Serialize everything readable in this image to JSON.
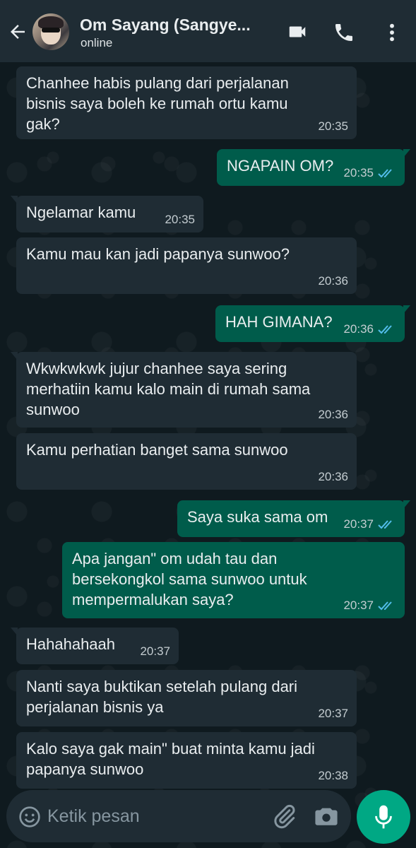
{
  "header": {
    "title": "Om Sayang (Sangye...",
    "status": "online"
  },
  "messages": [
    {
      "dir": "in",
      "text": "Chanhee habis pulang dari perjalanan\nbisnis saya boleh ke rumah ortu kamu\ngak?",
      "time": "20:35"
    },
    {
      "dir": "out",
      "text": "NGAPAIN OM?",
      "time": "20:35",
      "read": true
    },
    {
      "dir": "in",
      "text": "Ngelamar kamu",
      "time": "20:35"
    },
    {
      "dir": "in",
      "text": "Kamu mau kan jadi papanya sunwoo?",
      "time": "20:36"
    },
    {
      "dir": "out",
      "text": "HAH GIMANA?",
      "time": "20:36",
      "read": true
    },
    {
      "dir": "in",
      "text": "Wkwkwkwk jujur chanhee saya sering\nmerhatiin kamu kalo main di rumah sama\nsunwoo",
      "time": "20:36"
    },
    {
      "dir": "in",
      "text": "Kamu perhatian banget sama sunwoo",
      "time": "20:36"
    },
    {
      "dir": "out",
      "text": "Saya suka sama om",
      "time": "20:37",
      "read": true
    },
    {
      "dir": "out",
      "text": "Apa jangan\" om udah tau dan\nbersekongkol sama sunwoo untuk\nmempermalukan saya?",
      "time": "20:37",
      "read": true
    },
    {
      "dir": "in",
      "text": "Hahahahaah",
      "time": "20:37"
    },
    {
      "dir": "in",
      "text": "Nanti saya buktikan setelah pulang dari\nperjalanan bisnis ya",
      "time": "20:37"
    },
    {
      "dir": "in",
      "text": "Kalo saya gak main\" buat minta kamu jadi\npapanya sunwoo",
      "time": "20:38"
    }
  ],
  "composer": {
    "placeholder": "Ketik pesan"
  },
  "icons": {
    "back": "arrow-left-icon",
    "video": "video-call-icon",
    "call": "phone-icon",
    "menu": "more-vertical-icon",
    "emoji": "emoji-icon",
    "attach": "paperclip-icon",
    "camera": "camera-icon",
    "mic": "microphone-icon"
  },
  "colors": {
    "header": "#1f2c34",
    "incoming_bubble": "#1f2c34",
    "outgoing_bubble": "#005c4b",
    "read_ticks": "#53bdeb",
    "mic_button": "#00a884"
  }
}
